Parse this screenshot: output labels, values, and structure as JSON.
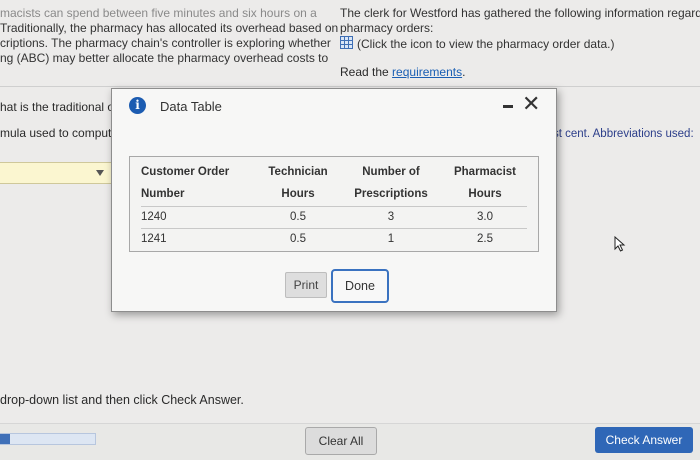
{
  "background": {
    "top_cut_text": "macists can spend between five minutes and six hours on a",
    "left_lines": [
      "Traditionally, the pharmacy has allocated its overhead based on",
      "criptions. The pharmacy chain's controller is exploring whether",
      "ng (ABC) may better allocate the pharmacy overhead costs to"
    ],
    "right_lines": [
      "The clerk for Westford has gathered the following information regarding",
      "pharmacy orders:",
      "(Click the icon to view the pharmacy order data.)"
    ],
    "read_prefix": "Read the ",
    "read_link": "requirements",
    "read_suffix": ".",
    "question_lines": [
      "hat is the traditional o",
      "mula used to comput"
    ],
    "abbrev_note": "st cent. Abbreviations used:",
    "instruction": "drop-down list and then click Check Answer.",
    "progress_fraction": 0.1
  },
  "modal": {
    "title": "Data Table",
    "headers": [
      [
        "Customer Order",
        "Number"
      ],
      [
        "Technician",
        "Hours"
      ],
      [
        "Number of",
        "Prescriptions"
      ],
      [
        "Pharmacist",
        "Hours"
      ]
    ],
    "rows": [
      [
        "1240",
        "0.5",
        "3",
        "3.0"
      ],
      [
        "1241",
        "0.5",
        "1",
        "2.5"
      ]
    ],
    "print_label": "Print",
    "done_label": "Done"
  },
  "footer": {
    "clear_all": "Clear All",
    "check_answer": "Check Answer"
  },
  "colors": {
    "accent": "#2f67b7",
    "link": "#1a5fb4",
    "dropdown_bg": "#fbf6d0",
    "info_icon": "#1c5cb1"
  }
}
